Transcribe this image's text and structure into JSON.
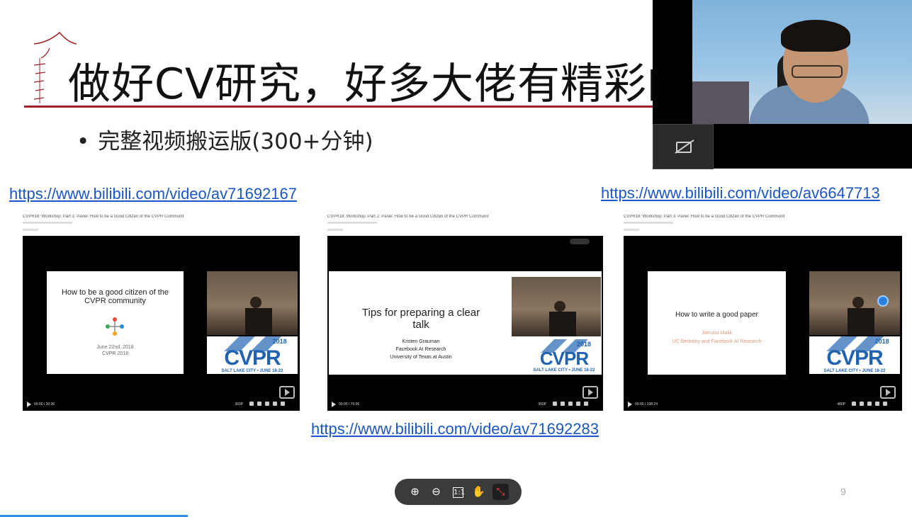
{
  "slide": {
    "title": "做好CV研究，好多大佬有精彩的",
    "bullet": "完整视频搬运版(300+分钟)",
    "page_number": "9"
  },
  "links": {
    "left": "https://www.bilibili.com/video/av71692167",
    "center": "https://www.bilibili.com/video/av71692283",
    "right": "https://www.bilibili.com/video/av6647713"
  },
  "thumbnails": [
    {
      "header": "CVPR18: Workshop: Part 1: Panel: How to be a Good Citizen of the CVPR Communit",
      "card_title": "How to be a good citizen of the CVPR community",
      "card_date": "June 22nd, 2018",
      "card_event": "CVPR 2018",
      "time": "00:00 / 30:36",
      "quality": "360P"
    },
    {
      "header": "CVPR18: Workshop: Part 2: Panel: How to be a Good Citizen of the CVPR Communit",
      "card_title": "Tips for preparing a clear talk",
      "card_author": "Kristen Grauman",
      "card_aff1": "Facebook AI Research",
      "card_aff2": "University of Texas at Austin",
      "time": "00:00 / 70:06",
      "quality": "360P"
    },
    {
      "header": "CVPR18: Workshop: Part 3: Panel: How to be a Good Citizen of the CVPR Communit",
      "card_title": "How to write a good paper",
      "card_author": "Jitendra Malik",
      "card_aff1": "UC Berkeley and Facebook AI Research",
      "time": "00:00 / 108:24",
      "quality": "480P"
    }
  ],
  "cvpr_logo": {
    "year": "2018",
    "word": "CVPR",
    "city": "SALT LAKE CITY • JUNE 18-22"
  },
  "toolbar": {
    "zoom_in": "⊕",
    "zoom_out": "⊖",
    "fit": "1:1",
    "pan": "✋",
    "collapse": "⤡"
  },
  "colors": {
    "accent_rule": "#a2202a",
    "link": "#1a56c7",
    "progress": "#2d8ee3"
  }
}
